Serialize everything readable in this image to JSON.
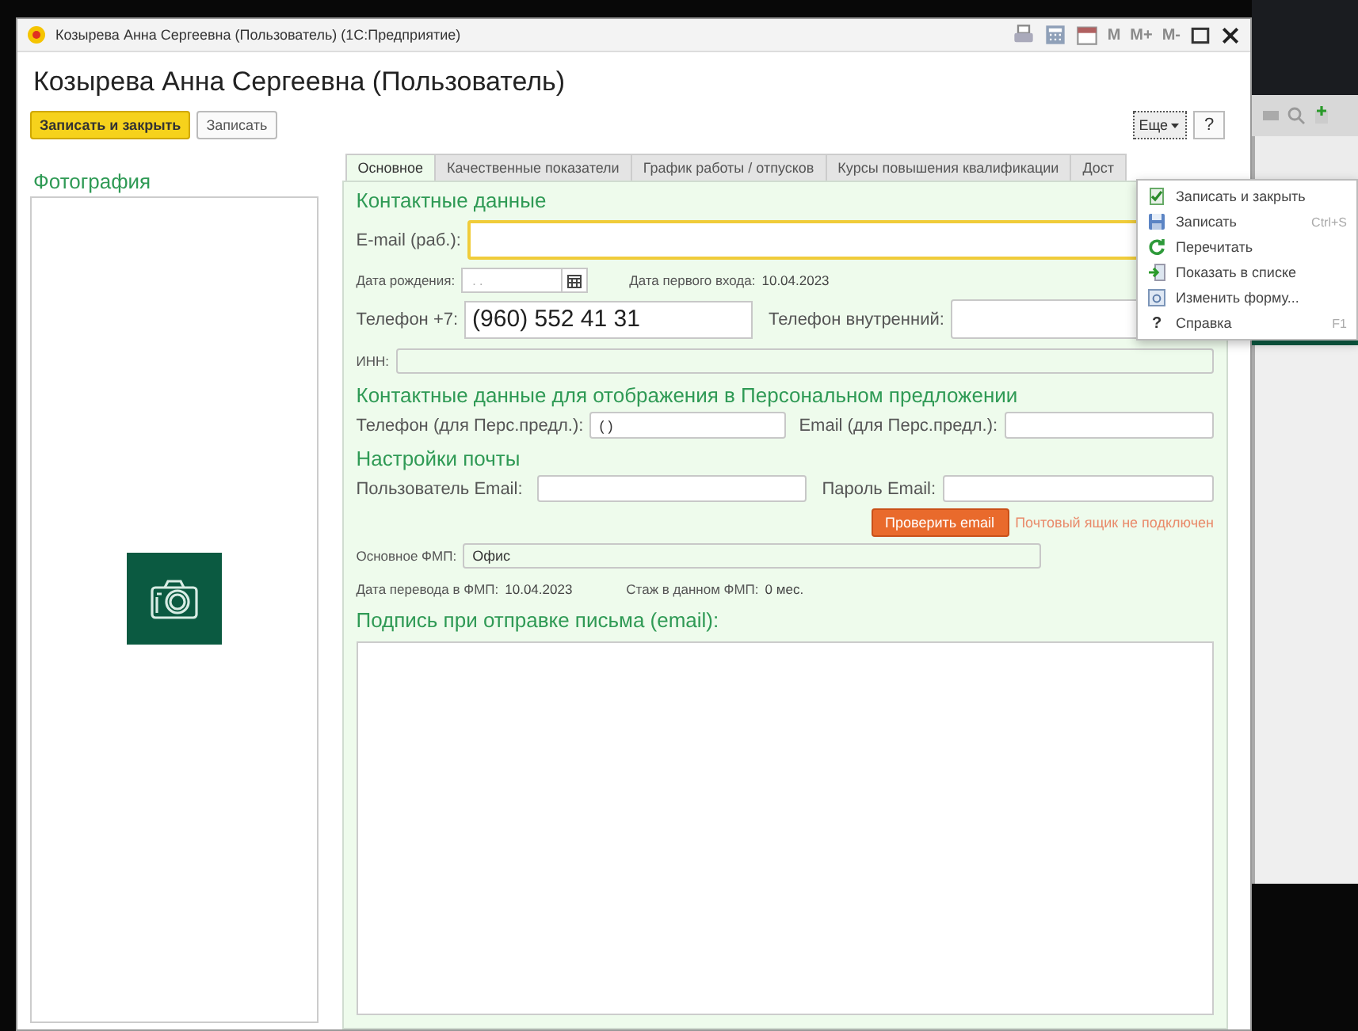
{
  "window": {
    "title": "Козырева Анна Сергеевна (Пользователь) (1С:Предприятие)",
    "memory_buttons": [
      "M",
      "M+",
      "M-"
    ]
  },
  "form": {
    "title": "Козырева Анна Сергеевна (Пользователь)"
  },
  "toolbar": {
    "buttons": [
      {
        "label": "Записать и закрыть",
        "default": true
      },
      {
        "label": "Записать",
        "default": false
      }
    ],
    "more": "Еще",
    "help": "?"
  },
  "photo": {
    "title": "Фотография"
  },
  "tabs": [
    {
      "label": "Основное",
      "selected": true
    },
    {
      "label": "Качественные показатели",
      "selected": false
    },
    {
      "label": "График работы / отпусков",
      "selected": false
    },
    {
      "label": "Курсы повышения квалификации",
      "selected": false
    },
    {
      "label": "Дост",
      "selected": false
    }
  ],
  "contacts": {
    "heading": "Контактные данные",
    "email": {
      "label": "E-mail (раб.):",
      "focused": true
    },
    "birth_date": {
      "label": "Дата рождения:",
      "placeholder": ". ."
    },
    "first_login": {
      "label": "Дата первого входа:",
      "value": "10.04.2023"
    },
    "phone": {
      "label": "Телефон +7:",
      "value": "(960) 552 41 31"
    },
    "internal_phone": {
      "label": "Телефон внутренний:"
    },
    "inn": {
      "label": "ИНН:"
    }
  },
  "personal_offer": {
    "heading": "Контактные данные для отображения в Персональном предложении",
    "phone": {
      "label": "Телефон (для Перс.предл.):",
      "value": "( )"
    },
    "email": {
      "label": "Email (для Перс.предл.):"
    }
  },
  "mail": {
    "heading": "Настройки почты",
    "user": {
      "label": "Пользователь Email:"
    },
    "password": {
      "label": "Пароль Email:"
    },
    "check_button": "Проверить email",
    "status": "Почтовый ящик не подключен"
  },
  "fmp": {
    "label": "Основное ФМП:",
    "value": "Офис"
  },
  "transfer": {
    "label": "Дата перевода в ФМП:",
    "value": "10.04.2023",
    "tenure_label": "Стаж в данном ФМП:",
    "tenure_value": "0 мес."
  },
  "signature": {
    "heading": "Подпись при отправке письма (email):"
  },
  "menu": [
    {
      "kind": "write-close",
      "label": "Записать и закрыть"
    },
    {
      "kind": "save",
      "label": "Записать",
      "shortcut": "Ctrl+S"
    },
    {
      "kind": "refresh",
      "label": "Перечитать"
    },
    {
      "kind": "list",
      "label": "Показать в списке"
    },
    {
      "kind": "form",
      "label": "Изменить форму..."
    },
    {
      "kind": "help",
      "glyph": "?",
      "label": "Справка",
      "shortcut": "F1"
    }
  ]
}
